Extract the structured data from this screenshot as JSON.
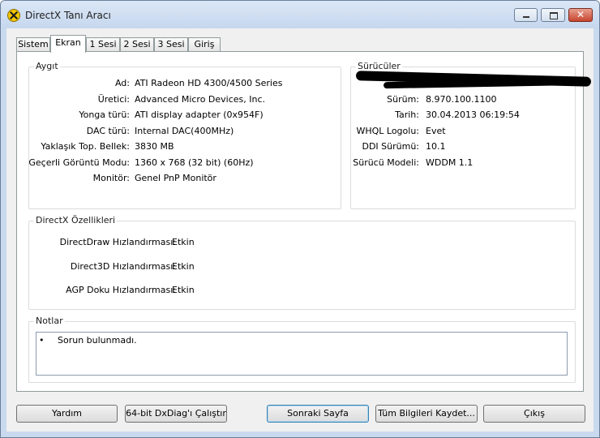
{
  "window": {
    "title": "DirectX Tanı Aracı"
  },
  "tabs": [
    "Sistem",
    "Ekran",
    "1 Sesi",
    "2 Sesi",
    "3 Sesi",
    "Giriş"
  ],
  "device": {
    "legend": "Aygıt",
    "rows": [
      {
        "label": "Ad:",
        "value": "ATI Radeon HD 4300/4500 Series"
      },
      {
        "label": "Üretici:",
        "value": "Advanced Micro Devices, Inc."
      },
      {
        "label": "Yonga türü:",
        "value": "ATI display adapter (0x954F)"
      },
      {
        "label": "DAC türü:",
        "value": "Internal DAC(400MHz)"
      },
      {
        "label": "Yaklaşık Top. Bellek:",
        "value": "3830 MB"
      },
      {
        "label": "Geçerli Görüntü Modu:",
        "value": "1360 x 768 (32 bit) (60Hz)"
      },
      {
        "label": "Monitör:",
        "value": "Genel PnP Monitör"
      }
    ]
  },
  "drivers": {
    "legend": "Sürücüler",
    "rows": [
      {
        "label": "Sürüm:",
        "value": "8.970.100.1100"
      },
      {
        "label": "Tarih:",
        "value": "30.04.2013 06:19:54"
      },
      {
        "label": "WHQL Logolu:",
        "value": "Evet"
      },
      {
        "label": "DDI Sürümü:",
        "value": "10.1"
      },
      {
        "label": "Sürücü Modeli:",
        "value": "WDDM 1.1"
      }
    ]
  },
  "features": {
    "legend": "DirectX Özellikleri",
    "rows": [
      {
        "label": "DirectDraw Hızlandırması:",
        "value": "Etkin"
      },
      {
        "label": "Direct3D Hızlandırması:",
        "value": "Etkin"
      },
      {
        "label": "AGP Doku Hızlandırması:",
        "value": "Etkin"
      }
    ]
  },
  "notes": {
    "legend": "Notlar",
    "bullet": "•",
    "text": "Sorun bulunmadı."
  },
  "buttons": [
    "Yardım",
    "64-bit DxDiag'ı Çalıştır",
    "Sonraki Sayfa",
    "Tüm Bilgileri Kaydet...",
    "Çıkış"
  ]
}
